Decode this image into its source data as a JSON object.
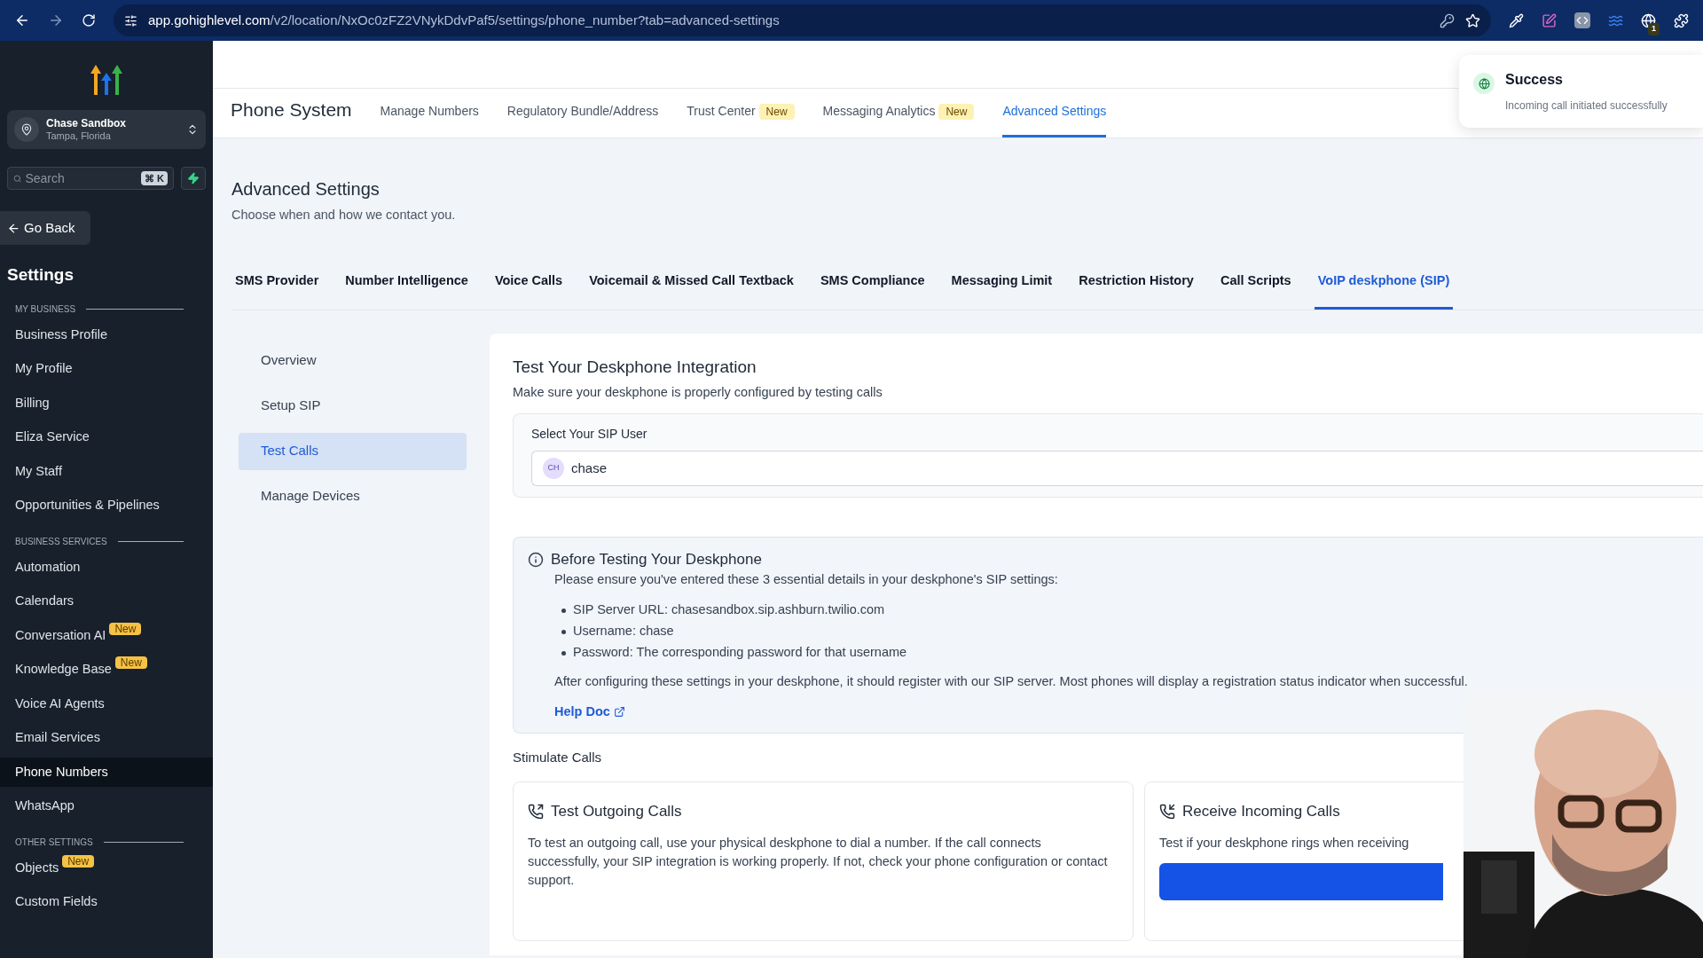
{
  "browser": {
    "url_host": "app.gohighlevel.com",
    "url_path": "/v2/location/NxOc0zFZ2VNykDdvPaf5/settings/phone_number?tab=advanced-settings",
    "extension_badge": "1"
  },
  "sidebar": {
    "account": {
      "name": "Chase Sandbox",
      "location": "Tampa, Florida"
    },
    "search": {
      "placeholder": "Search",
      "shortcut": "⌘ K"
    },
    "back_button": "Go Back",
    "title": "Settings",
    "sections": [
      {
        "heading": "MY BUSINESS",
        "items": [
          {
            "label": "Business Profile",
            "selected": false
          },
          {
            "label": "My Profile",
            "selected": false
          },
          {
            "label": "Billing",
            "selected": false
          },
          {
            "label": "Eliza Service",
            "selected": false
          },
          {
            "label": "My Staff",
            "selected": false
          },
          {
            "label": "Opportunities & Pipelines",
            "selected": false
          }
        ]
      },
      {
        "heading": "BUSINESS SERVICES",
        "items": [
          {
            "label": "Automation",
            "selected": false
          },
          {
            "label": "Calendars",
            "selected": false
          },
          {
            "label": "Conversation AI",
            "selected": false,
            "badge": "New"
          },
          {
            "label": "Knowledge Base",
            "selected": false,
            "badge": "New"
          },
          {
            "label": "Voice AI Agents",
            "selected": false
          },
          {
            "label": "Email Services",
            "selected": false
          },
          {
            "label": "Phone Numbers",
            "selected": true
          },
          {
            "label": "WhatsApp",
            "selected": false
          }
        ]
      },
      {
        "heading": "OTHER SETTINGS",
        "items": [
          {
            "label": "Objects",
            "selected": false,
            "badge": "New"
          },
          {
            "label": "Custom Fields",
            "selected": false
          }
        ]
      }
    ]
  },
  "header": {
    "title": "Phone System",
    "tabs": [
      {
        "label": "Manage Numbers",
        "selected": false
      },
      {
        "label": "Regulatory Bundle/Address",
        "selected": false
      },
      {
        "label": "Trust Center",
        "selected": false,
        "badge": "New"
      },
      {
        "label": "Messaging Analytics",
        "selected": false,
        "badge": "New"
      },
      {
        "label": "Advanced Settings",
        "selected": true
      }
    ]
  },
  "toast": {
    "title": "Success",
    "message": "Incoming call initiated successfully"
  },
  "page": {
    "title": "Advanced Settings",
    "subtitle": "Choose when and how we contact you.",
    "tabs": [
      {
        "label": "SMS Provider",
        "selected": false
      },
      {
        "label": "Number Intelligence",
        "selected": false
      },
      {
        "label": "Voice Calls",
        "selected": false
      },
      {
        "label": "Voicemail & Missed Call Textback",
        "selected": false
      },
      {
        "label": "SMS Compliance",
        "selected": false
      },
      {
        "label": "Messaging Limit",
        "selected": false
      },
      {
        "label": "Restriction History",
        "selected": false
      },
      {
        "label": "Call Scripts",
        "selected": false
      },
      {
        "label": "VoIP deskphone (SIP)",
        "selected": true
      }
    ],
    "subnav": [
      {
        "label": "Overview",
        "selected": false
      },
      {
        "label": "Setup SIP",
        "selected": false
      },
      {
        "label": "Test Calls",
        "selected": true
      },
      {
        "label": "Manage Devices",
        "selected": false
      }
    ],
    "card": {
      "title": "Test Your Deskphone Integration",
      "subtitle": "Make sure your deskphone is properly configured by testing calls",
      "select_label": "Select Your SIP User",
      "user_initials": "CH",
      "user_value": "chase",
      "info": {
        "title": "Before Testing Your Deskphone",
        "intro": "Please ensure you've entered these 3 essential details in your deskphone's SIP settings:",
        "bullets": [
          "SIP Server URL: chasesandbox.sip.ashburn.twilio.com",
          "Username: chase",
          "Password: The corresponding password for that username"
        ],
        "note": "After configuring these settings in your deskphone, it should register with our SIP server. Most phones will display a registration status indicator when successful.",
        "link": "Help Doc"
      },
      "calls_heading": "Stimulate Calls",
      "calls": [
        {
          "kind": "outgoing",
          "title": "Test Outgoing Calls",
          "text": "To test an outgoing call, use your physical deskphone to dial a number. If the call connects successfully, your SIP integration is working properly. If not, check your phone configuration or contact support."
        },
        {
          "kind": "incoming",
          "title": "Receive Incoming Calls",
          "text": "Test if your deskphone rings when receiving"
        }
      ]
    }
  }
}
